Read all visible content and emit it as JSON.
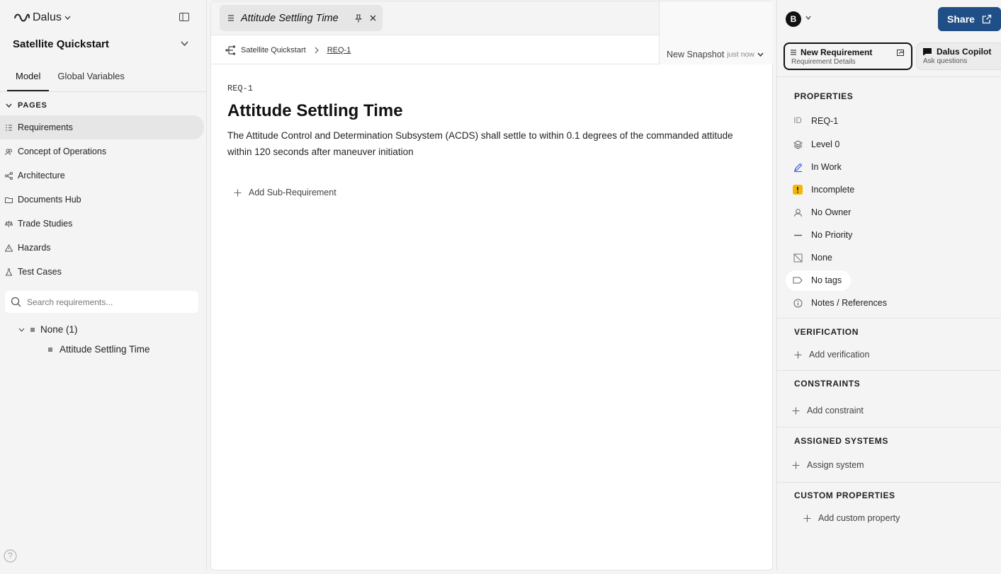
{
  "sidebar": {
    "logo_text": "Dalus",
    "project_title": "Satellite Quickstart",
    "tabs": [
      "Model",
      "Global Variables"
    ],
    "pages_header": "PAGES",
    "nav_items": [
      {
        "label": "Requirements",
        "icon": "list-icon"
      },
      {
        "label": "Concept of Operations",
        "icon": "people-icon"
      },
      {
        "label": "Architecture",
        "icon": "network-icon"
      },
      {
        "label": "Documents Hub",
        "icon": "folder-icon"
      },
      {
        "label": "Trade Studies",
        "icon": "scale-icon"
      },
      {
        "label": "Hazards",
        "icon": "warning-icon"
      },
      {
        "label": "Test Cases",
        "icon": "flask-icon"
      }
    ],
    "search_placeholder": "Search requirements...",
    "tree_group": "None (1)",
    "tree_leaf": "Attitude Settling Time",
    "help_label": "?"
  },
  "main": {
    "tab_title": "Attitude Settling Time",
    "breadcrumb": {
      "root": "Satellite Quickstart",
      "current": "REQ-1"
    },
    "snapshot": {
      "label": "New Snapshot",
      "time": "just now"
    },
    "req_id": "REQ-1",
    "req_title": "Attitude Settling Time",
    "req_desc": "The Attitude Control and Determination Subsystem (ACDS) shall settle to within 0.1 degrees of the commanded attitude within 120 seconds after maneuver initiation",
    "add_sub_label": "Add Sub-Requirement"
  },
  "right": {
    "avatar": "B",
    "share_label": "Share",
    "tabs": [
      {
        "title": "New Requirement",
        "subtitle": "Requirement Details"
      },
      {
        "title": "Dalus Copilot",
        "subtitle": "Ask questions"
      }
    ],
    "properties_title": "PROPERTIES",
    "properties": {
      "id_label": "ID",
      "id_value": "REQ-1",
      "level": "Level 0",
      "status": "In Work",
      "completeness": "Incomplete",
      "owner": "No Owner",
      "priority": "No Priority",
      "type": "None",
      "tags": "No tags",
      "notes": "Notes / References"
    },
    "verification_title": "VERIFICATION",
    "add_verification": "Add verification",
    "constraints_title": "CONSTRAINTS",
    "add_constraint": "Add constraint",
    "assigned_title": "ASSIGNED SYSTEMS",
    "assign_system": "Assign system",
    "custom_title": "CUSTOM PROPERTIES",
    "add_custom": "Add custom property",
    "colors": {
      "share": "#1f4f86",
      "warning": "#f2b705",
      "status_pen": "#3b5bdb"
    }
  }
}
